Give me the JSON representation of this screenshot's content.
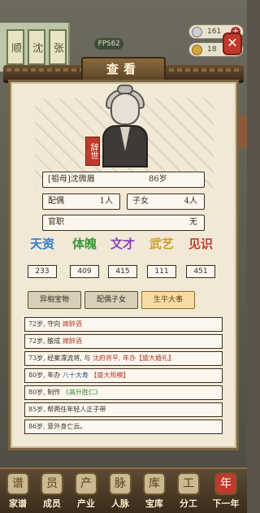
{
  "hud": {
    "fps": "FPS62",
    "silver": "161",
    "gold": "18",
    "left_tiles": [
      "顺",
      "沈",
      "张"
    ]
  },
  "dialog": {
    "title": "查看",
    "close_icon": "close-icon",
    "seal_text": "辞世"
  },
  "person": {
    "name": "[祖母]沈微眉",
    "age": "86岁",
    "spouse_label": "配偶",
    "spouse_count": "1人",
    "children_label": "子女",
    "children_count": "4人",
    "title_label": "官职",
    "title_value": "无"
  },
  "attributes": [
    {
      "label": "天资",
      "value": "233",
      "color": "#2f7fd0"
    },
    {
      "label": "体魄",
      "value": "409",
      "color": "#3a9a3a"
    },
    {
      "label": "文才",
      "value": "415",
      "color": "#8a3fbf"
    },
    {
      "label": "武艺",
      "value": "111",
      "color": "#c9a026"
    },
    {
      "label": "见识",
      "value": "451",
      "color": "#c0392b"
    }
  ],
  "tabs": [
    {
      "label": "异相宝物",
      "active": false
    },
    {
      "label": "配偶子女",
      "active": false
    },
    {
      "label": "生平大事",
      "active": true
    }
  ],
  "events": [
    {
      "age": "72岁,",
      "text": "守向",
      "hl": "嫁醉酒",
      "rest": ""
    },
    {
      "age": "72岁,",
      "text": "酿成",
      "hl": "嫁醉酒",
      "rest": ""
    },
    {
      "age": "73岁,",
      "text": "经案漂流将, 与",
      "hl": "",
      "rest": "沈府将平, 年办【盛大婚礼】"
    },
    {
      "age": "80岁,",
      "text": "年办",
      "hl": "八十大寿",
      "rest": "【盛大规模】"
    },
    {
      "age": "80岁,",
      "text": "制作",
      "hl": "《高升胜仁》",
      "rest": ""
    },
    {
      "age": "85岁,",
      "text": "帮两任年轻人正子带",
      "hl": "",
      "rest": ""
    },
    {
      "age": "86岁,",
      "text": "意外身亡云。",
      "hl": "",
      "rest": ""
    }
  ],
  "bottom_nav": [
    {
      "label": "家谱",
      "icon": "family-tree-icon",
      "glyph": "谱"
    },
    {
      "label": "成员",
      "icon": "member-icon",
      "glyph": "员"
    },
    {
      "label": "产业",
      "icon": "property-icon",
      "glyph": "产"
    },
    {
      "label": "人脉",
      "icon": "connection-icon",
      "glyph": "脉"
    },
    {
      "label": "宝库",
      "icon": "treasury-icon",
      "glyph": "库"
    },
    {
      "label": "分工",
      "icon": "division-icon",
      "glyph": "工"
    },
    {
      "label": "下一年",
      "icon": "next-year-icon",
      "glyph": "年"
    }
  ]
}
